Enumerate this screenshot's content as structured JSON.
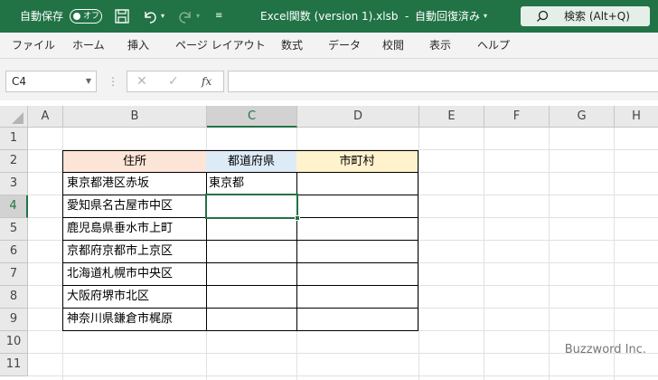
{
  "titlebar": {
    "autosave_label": "自動保存",
    "autosave_state": "オフ",
    "document_title": "Excel関数 (version 1).xlsb",
    "save_status": "自動回復済み",
    "search_label": "検索 (Alt+Q)",
    "background_color": "#217346"
  },
  "ribbon_tabs": [
    "ファイル",
    "ホーム",
    "挿入",
    "ページ レイアウト",
    "数式",
    "データ",
    "校閲",
    "表示",
    "ヘルプ"
  ],
  "formula_bar": {
    "name_box": "C4",
    "fx_label": "fx",
    "formula_value": ""
  },
  "sheet": {
    "columns": [
      "A",
      "B",
      "C",
      "D",
      "E",
      "F",
      "G",
      "H"
    ],
    "rows": [
      "1",
      "2",
      "3",
      "4",
      "5",
      "6",
      "7",
      "8",
      "9",
      "10",
      "11"
    ],
    "active_cell": "C4",
    "table": {
      "headers": [
        "住所",
        "都道府県",
        "市町村"
      ],
      "header_colors": [
        "#fce4d6",
        "#ddebf7",
        "#fff2cc"
      ],
      "rows": [
        [
          "東京都港区赤坂",
          "東京都",
          ""
        ],
        [
          "愛知県名古屋市中区",
          "",
          ""
        ],
        [
          "鹿児島県垂水市上町",
          "",
          ""
        ],
        [
          "京都府京都市上京区",
          "",
          ""
        ],
        [
          "北海道札幌市中央区",
          "",
          ""
        ],
        [
          "大阪府堺市北区",
          "",
          ""
        ],
        [
          "神奈川県鎌倉市梶原",
          "",
          ""
        ]
      ]
    }
  },
  "watermark": "Buzzword Inc."
}
